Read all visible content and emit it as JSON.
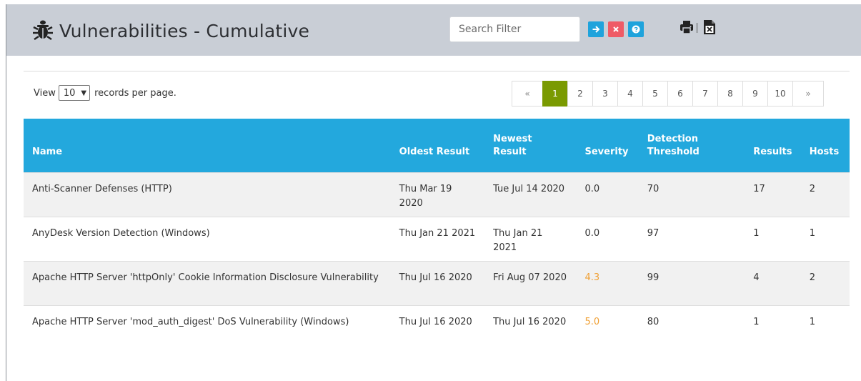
{
  "header": {
    "title": "Vulnerabilities - Cumulative",
    "icon": "bug-icon",
    "search": {
      "placeholder": "Search Filter",
      "value": ""
    },
    "buttons": {
      "go": {
        "icon": "arrow-right-icon",
        "color": "#1fa3dc"
      },
      "clear": {
        "icon": "close-icon",
        "color": "#ef5b66"
      },
      "help": {
        "icon": "question-icon",
        "color": "#1fa3dc"
      },
      "print": {
        "icon": "print-icon"
      },
      "excel": {
        "icon": "excel-icon"
      }
    }
  },
  "controls": {
    "view_label": "View",
    "per_page_value": "10",
    "per_page_suffix": "records per page."
  },
  "pagination": {
    "prev": "«",
    "next": "»",
    "pages": [
      "1",
      "2",
      "3",
      "4",
      "5",
      "6",
      "7",
      "8",
      "9",
      "10"
    ],
    "active": "1",
    "active_color": "#7a9a01"
  },
  "table": {
    "header_color": "#23a8dd",
    "columns": [
      "Name",
      "Oldest Result",
      "Newest Result",
      "Severity",
      "Detection Threshold",
      "Results",
      "Hosts"
    ],
    "rows": [
      {
        "name": "Anti-Scanner Defenses (HTTP)",
        "oldest": "Thu Mar 19 2020",
        "newest": "Tue Jul 14 2020",
        "severity": "0.0",
        "threshold": "70",
        "results": "17",
        "hosts": "2"
      },
      {
        "name": "AnyDesk Version Detection (Windows)",
        "oldest": "Thu Jan 21 2021",
        "newest": "Thu Jan 21 2021",
        "severity": "0.0",
        "threshold": "97",
        "results": "1",
        "hosts": "1"
      },
      {
        "name": "Apache HTTP Server 'httpOnly' Cookie Information Disclosure Vulnerability",
        "oldest": "Thu Jul 16 2020",
        "newest": "Fri Aug 07 2020",
        "severity": "4.3",
        "threshold": "99",
        "results": "4",
        "hosts": "2"
      },
      {
        "name": "Apache HTTP Server 'mod_auth_digest' DoS Vulnerability (Windows)",
        "oldest": "Thu Jul 16 2020",
        "newest": "Thu Jul 16 2020",
        "severity": "5.0",
        "threshold": "80",
        "results": "1",
        "hosts": "1"
      }
    ],
    "severity_warn_color": "#f0a035"
  }
}
